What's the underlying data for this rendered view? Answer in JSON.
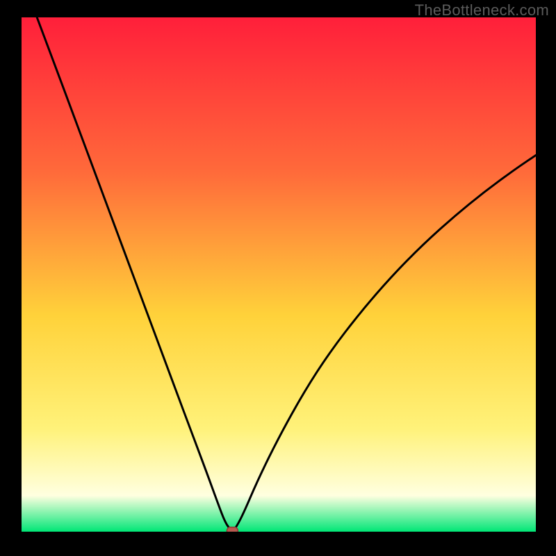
{
  "watermark": "TheBottleneck.com",
  "colors": {
    "frame": "#000000",
    "curve": "#000000",
    "marker_fill": "#b85a50",
    "marker_stroke": "#8a3c34",
    "grad_top": "#ff1f3a",
    "grad_upper": "#ff6a3a",
    "grad_mid": "#ffd23a",
    "grad_lower": "#fff27a",
    "grad_cream": "#ffffe0",
    "grad_green": "#00e676"
  },
  "chart_data": {
    "type": "line",
    "title": "",
    "xlabel": "",
    "ylabel": "",
    "xlim": [
      0,
      100
    ],
    "ylim": [
      0,
      100
    ],
    "x": [
      3,
      6,
      10,
      14,
      18,
      22,
      26,
      30,
      33,
      36,
      38,
      39.5,
      40.5,
      41,
      41.5,
      43,
      46,
      50,
      55,
      60,
      66,
      72,
      78,
      84,
      90,
      96,
      100
    ],
    "values": [
      100,
      92,
      81.3,
      70.5,
      59.8,
      49,
      38.3,
      27.5,
      19.5,
      11.5,
      6,
      2,
      0.5,
      0.2,
      0.5,
      3.2,
      10.2,
      18.3,
      27.3,
      35,
      42.8,
      49.7,
      55.8,
      61.2,
      66.1,
      70.5,
      73.2
    ],
    "marker": {
      "x": 41,
      "y": 0.2
    },
    "grid": false,
    "legend": false
  }
}
